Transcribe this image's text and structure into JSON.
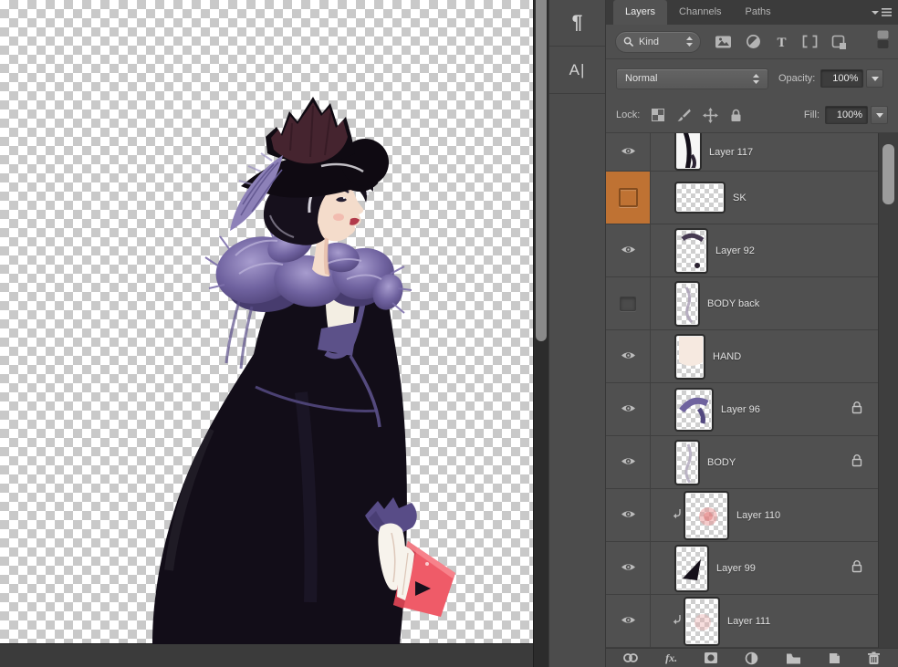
{
  "panel": {
    "tabs": [
      {
        "label": "Layers"
      },
      {
        "label": "Channels"
      },
      {
        "label": "Paths"
      }
    ],
    "filter": {
      "kind": "Kind"
    },
    "blend": {
      "mode": "Normal",
      "opacity_label": "Opacity:",
      "opacity_value": "100%"
    },
    "lock": {
      "label": "Lock:",
      "fill_label": "Fill:",
      "fill_value": "100%"
    },
    "layers": [
      {
        "name": "Layer 117",
        "eye": true,
        "clipped": false,
        "locked": false
      },
      {
        "name": "SK",
        "eye": false,
        "clipped": false,
        "locked": false,
        "label_color": "#bf7233"
      },
      {
        "name": "Layer 92",
        "eye": true,
        "clipped": false,
        "locked": false
      },
      {
        "name": "BODY back",
        "eye": false,
        "clipped": false,
        "locked": false
      },
      {
        "name": "HAND",
        "eye": true,
        "clipped": false,
        "locked": false
      },
      {
        "name": "Layer 96",
        "eye": true,
        "clipped": false,
        "locked": true
      },
      {
        "name": "BODY",
        "eye": true,
        "clipped": false,
        "locked": true
      },
      {
        "name": "Layer 110",
        "eye": true,
        "clipped": true,
        "locked": false
      },
      {
        "name": "Layer 99",
        "eye": true,
        "clipped": false,
        "locked": true
      },
      {
        "name": "Layer 111",
        "eye": true,
        "clipped": true,
        "locked": false
      }
    ],
    "bottom": {
      "fx_label": "fx."
    }
  },
  "dock": {
    "paragraph": "¶",
    "character": "A|"
  },
  "colors": {
    "panel_bg": "#4f4f4f",
    "tabbar_bg": "#3b3b3b",
    "row_bg": "#505050",
    "orange_label": "#bf7233",
    "checker_gray": "#c9c9c9",
    "pasteboard": "#3b3b3b",
    "boa_purple": "#6f639e",
    "dress_black": "#120d18",
    "book_pink": "#ef5b68"
  }
}
